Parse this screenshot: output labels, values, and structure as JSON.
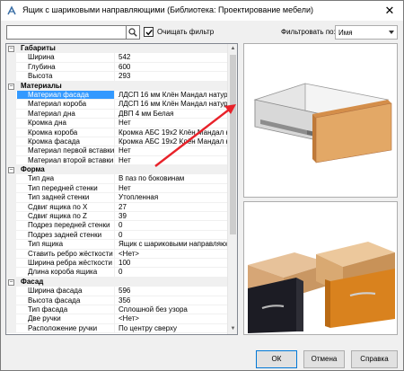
{
  "window": {
    "title": "Ящик с шариковыми направляющими (Библиотека: Проектирование мебели)",
    "close_symbol": "✕"
  },
  "toolbar": {
    "search_value": "",
    "search_icon": "search-icon",
    "clear_filter_checked": true,
    "clear_filter_label": "Очищать фильтр",
    "filter_label": "Фильтровать по:",
    "filter_value": "Имя"
  },
  "properties": [
    {
      "type": "category",
      "name": "Габариты",
      "toggle": "−"
    },
    {
      "type": "prop",
      "name": "Ширина",
      "value": "542"
    },
    {
      "type": "prop",
      "name": "Глубина",
      "value": "600"
    },
    {
      "type": "prop",
      "name": "Высота",
      "value": "293"
    },
    {
      "type": "category",
      "name": "Материалы",
      "toggle": "−"
    },
    {
      "type": "prop",
      "name": "Материал фасада",
      "value": "ЛДСП 16 мм Клён Мандал натура",
      "selected": true
    },
    {
      "type": "prop",
      "name": "Материал короба",
      "value": "ЛДСП 16 мм Клён Мандал натура"
    },
    {
      "type": "prop",
      "name": "Материал дна",
      "value": "ДВП 4 мм Белая"
    },
    {
      "type": "prop",
      "name": "Кромка дна",
      "value": "Нет"
    },
    {
      "type": "prop",
      "name": "Кромка короба",
      "value": "Кромка АБС 19x2 Клён Мандал на"
    },
    {
      "type": "prop",
      "name": "Кромка фасада",
      "value": "Кромка АБС 19x2 Клён Мандал на"
    },
    {
      "type": "prop",
      "name": "Материал первой вставки",
      "value": "Нет"
    },
    {
      "type": "prop",
      "name": "Материал второй вставки",
      "value": "Нет"
    },
    {
      "type": "category",
      "name": "Форма",
      "toggle": "−"
    },
    {
      "type": "prop",
      "name": "Тип дна",
      "value": "В паз по боковинам"
    },
    {
      "type": "prop",
      "name": "Тип передней стенки",
      "value": "Нет"
    },
    {
      "type": "prop",
      "name": "Тип задней стенки",
      "value": "Утопленная"
    },
    {
      "type": "prop",
      "name": "Сдвиг ящика по X",
      "value": "27"
    },
    {
      "type": "prop",
      "name": "Сдвиг ящика по Z",
      "value": "39"
    },
    {
      "type": "prop",
      "name": "Подрез передней стенки",
      "value": "0"
    },
    {
      "type": "prop",
      "name": "Подрез задней стенки",
      "value": "0"
    },
    {
      "type": "prop",
      "name": "Тип ящика",
      "value": "Ящик с шариковыми направляющ"
    },
    {
      "type": "prop",
      "name": "Ставить ребро жёсткости",
      "value": "<Нет>"
    },
    {
      "type": "prop",
      "name": "Ширина ребра жёсткости",
      "value": "100"
    },
    {
      "type": "prop",
      "name": "Длина короба ящика",
      "value": "0"
    },
    {
      "type": "category",
      "name": "Фасад",
      "toggle": "−"
    },
    {
      "type": "prop",
      "name": "Ширина фасада",
      "value": "596"
    },
    {
      "type": "prop",
      "name": "Высота фасада",
      "value": "356"
    },
    {
      "type": "prop",
      "name": "Тип фасада",
      "value": "Сплошной без узора"
    },
    {
      "type": "prop",
      "name": "Две ручки",
      "value": "<Нет>"
    },
    {
      "type": "prop",
      "name": "Расположение ручки",
      "value": "По центру сверху"
    }
  ],
  "buttons": {
    "ok": "ОК",
    "cancel": "Отмена",
    "help": "Справка"
  },
  "colors": {
    "selection": "#3399ff",
    "arrow": "#e8222a",
    "wood": "#e3a866",
    "dark_front": "#1c1c24",
    "orange_front": "#d9821e"
  }
}
